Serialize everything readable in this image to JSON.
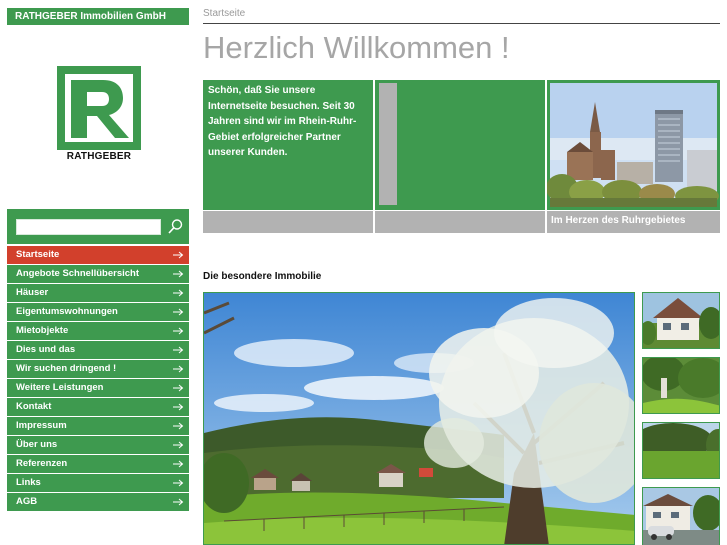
{
  "company": {
    "name": "RATHGEBER Immobilien GmbH",
    "logo_text": "RATHGEBER"
  },
  "search": {
    "value": "",
    "placeholder": ""
  },
  "nav": {
    "items": [
      {
        "label": "Startseite",
        "active": true
      },
      {
        "label": "Angebote Schnellübersicht",
        "active": false
      },
      {
        "label": "Häuser",
        "active": false
      },
      {
        "label": "Eigentumswohnungen",
        "active": false
      },
      {
        "label": "Mietobjekte",
        "active": false
      },
      {
        "label": "Dies und das",
        "active": false
      },
      {
        "label": "Wir suchen dringend !",
        "active": false
      },
      {
        "label": "Weitere Leistungen",
        "active": false
      },
      {
        "label": "Kontakt",
        "active": false
      },
      {
        "label": "Impressum",
        "active": false
      },
      {
        "label": "Über uns",
        "active": false
      },
      {
        "label": "Referenzen",
        "active": false
      },
      {
        "label": "Links",
        "active": false
      },
      {
        "label": "AGB",
        "active": false
      }
    ]
  },
  "breadcrumb": "Startseite",
  "page_title": "Herzlich Willkommen !",
  "intro": {
    "text": "Schön, daß Sie unsere Internetseite besuchen. Seit 30 Jahren sind wir im Rhein-Ruhr-Gebiet erfolgreicher Partner unserer Kunden.",
    "photo_caption": "Im Herzen des Ruhrgebietes"
  },
  "featured": {
    "heading": "Die besondere Immobilie"
  },
  "colors": {
    "brand_green": "#3e9a4f",
    "active_red": "#d2402c",
    "grey": "#b2b2b2",
    "title_grey": "#a6a6a6"
  },
  "icons": {
    "search": "search-icon",
    "nav_arrow": "arrow-right-icon",
    "logo": "rathgeber-r-logo"
  }
}
